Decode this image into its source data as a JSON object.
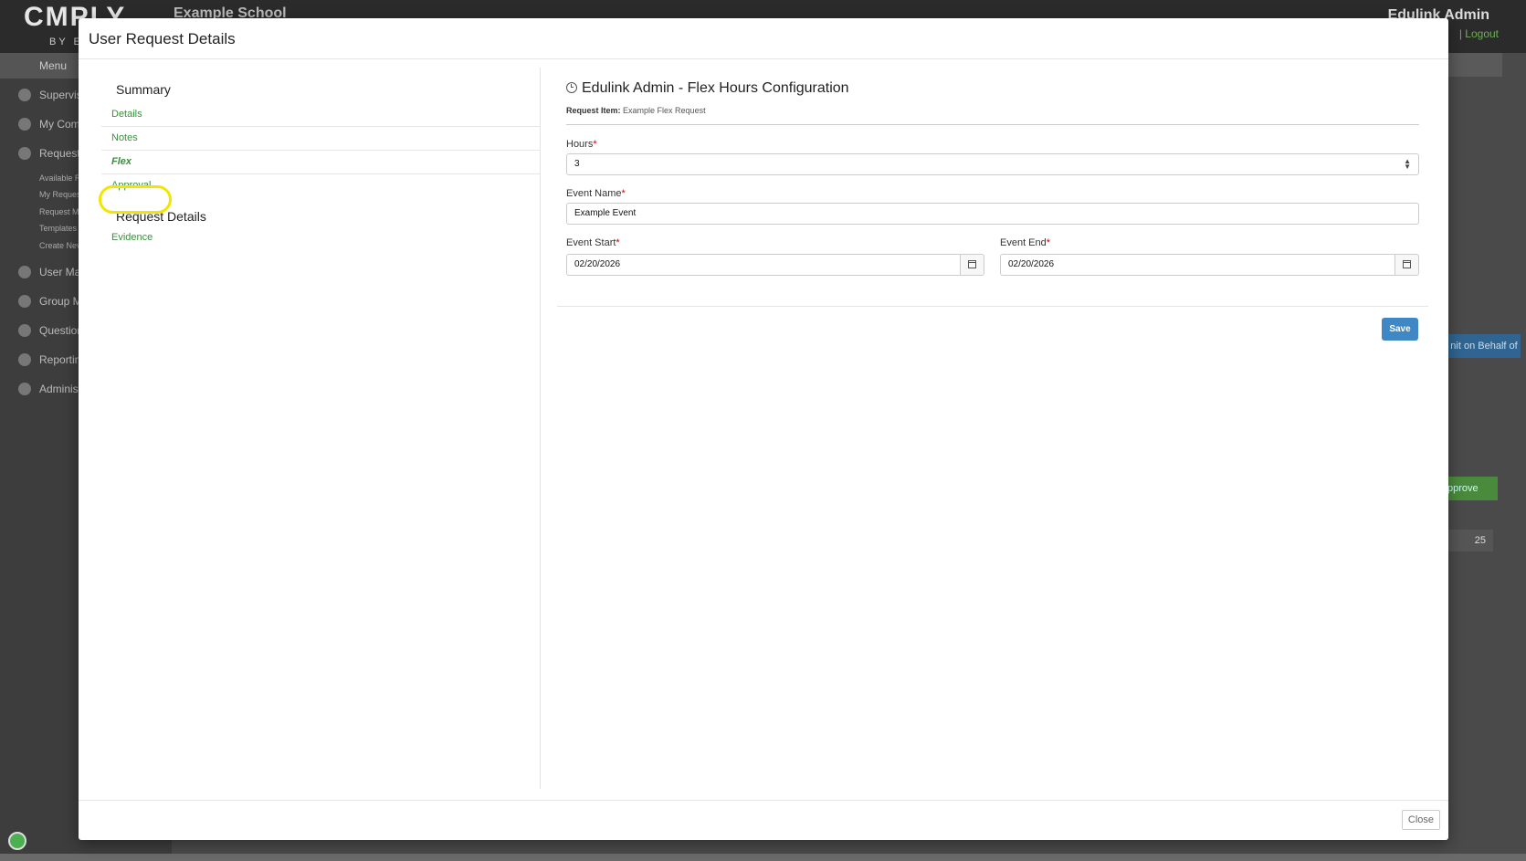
{
  "background": {
    "logo": "CMPLY",
    "logo_sub": "BY E",
    "school": "Example School",
    "user": "Edulink Admin",
    "logout": "| Logout",
    "menu_label": "Menu",
    "sidebar": [
      "Supervis",
      "My Comp",
      "Requests",
      "User Man",
      "Group M",
      "Question",
      "Reportin",
      "Administ"
    ],
    "sidebar_sub": [
      "Available R",
      "My Request",
      "Request M",
      "Templates",
      "Create Nev"
    ],
    "behalf_button": "nit on Behalf of",
    "approve_button": "pprove",
    "page_size": "25"
  },
  "modal": {
    "title": "User Request Details",
    "close_label": "Close"
  },
  "nav": {
    "summary_heading": "Summary",
    "request_details_heading": "Request Details",
    "items": {
      "details": "Details",
      "notes": "Notes",
      "flex": "Flex",
      "approval": "Approval",
      "evidence": "Evidence"
    }
  },
  "panel": {
    "title": "Edulink Admin - Flex Hours Configuration",
    "request_item_label": "Request Item:",
    "request_item_value": "Example Flex Request",
    "hours_label": "Hours",
    "hours_value": "3",
    "event_name_label": "Event Name",
    "event_name_value": "Example Event",
    "event_start_label": "Event Start",
    "event_start_value": "02/20/2026",
    "event_end_label": "Event End",
    "event_end_value": "02/20/2026",
    "required_mark": "*",
    "save_label": "Save"
  },
  "colors": {
    "accent_green": "#3c8d3f",
    "save_blue": "#3f88c5",
    "highlight_yellow": "#f2e600"
  }
}
